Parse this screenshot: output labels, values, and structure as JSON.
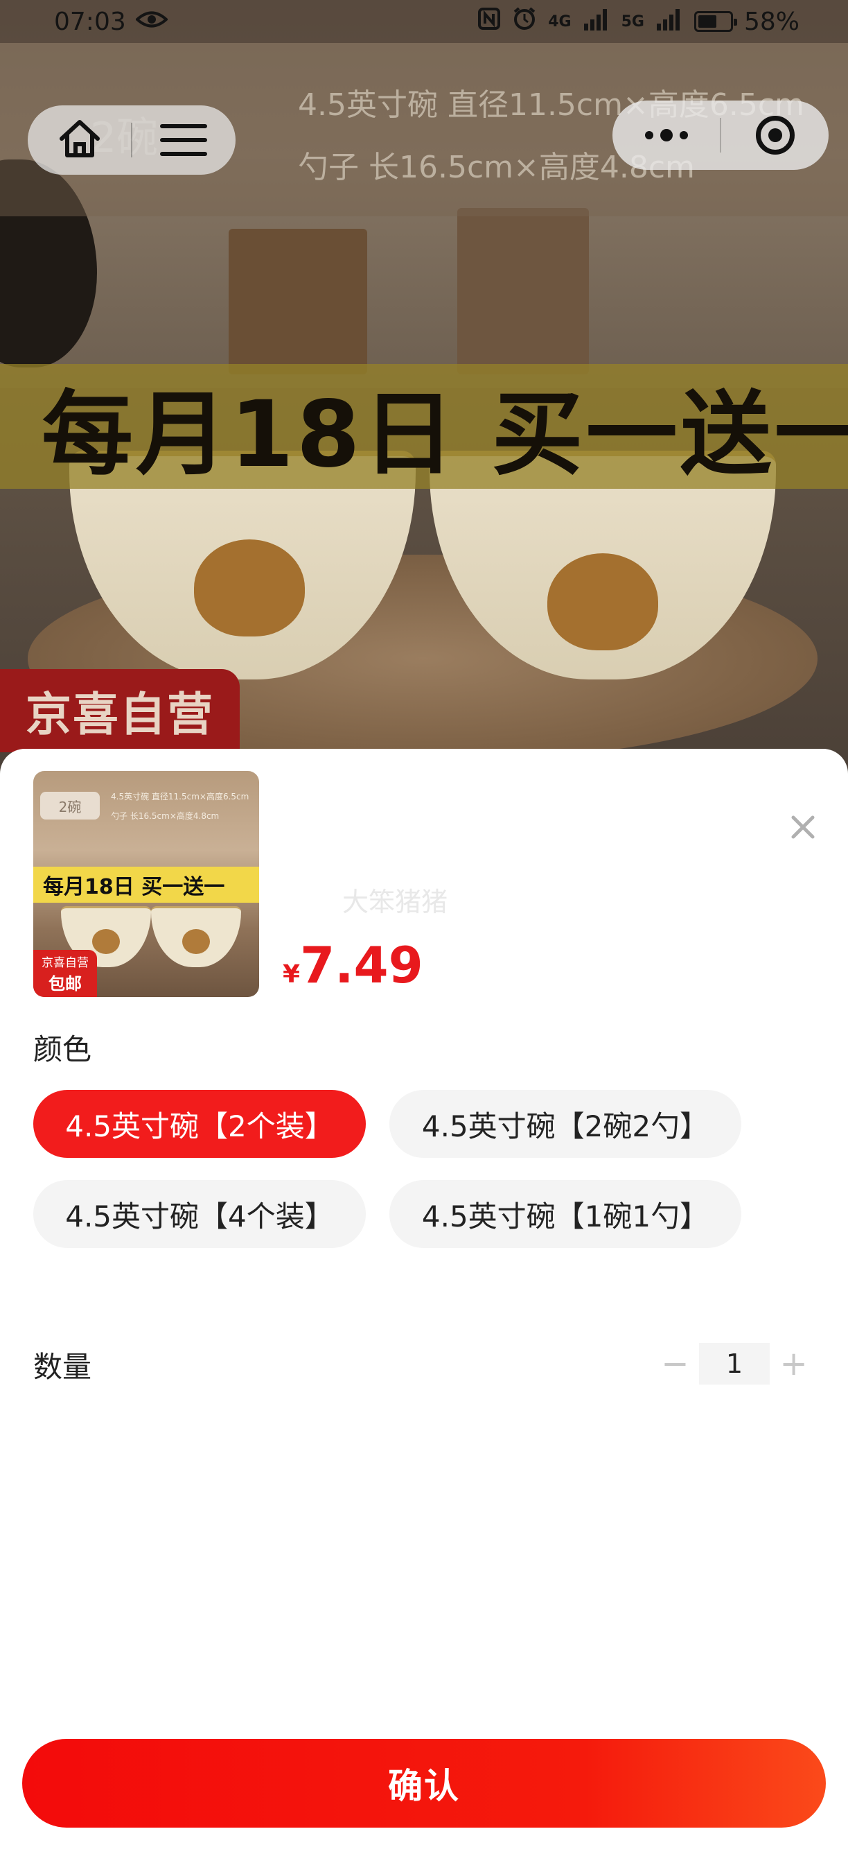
{
  "status_bar": {
    "time": "07:03",
    "battery": "58%",
    "signal_1": "4G",
    "signal_2": "5G"
  },
  "hero": {
    "spec_line_1": "4.5英寸碗 直径11.5cm×高度6.5cm",
    "spec_line_2": "勺子 长16.5cm×高度4.8cm",
    "tag": "2碗",
    "banner": "每月18日 买一送一",
    "store_tag": "京喜自营"
  },
  "sheet": {
    "thumbnail": {
      "tag": "2碗",
      "spec_line_1": "4.5英寸碗 直径11.5cm×高度6.5cm",
      "spec_line_2": "勺子 长16.5cm×高度4.8cm",
      "banner": "每月18日 买一送一",
      "badge_top": "京喜自营",
      "badge_bottom": "包邮"
    },
    "watermark": "大笨猪猪",
    "price_currency": "¥",
    "price_amount": "7.49",
    "color_label": "颜色",
    "options": [
      {
        "label": "4.5英寸碗【2个装】",
        "selected": true
      },
      {
        "label": "4.5英寸碗【2碗2勺】",
        "selected": false
      },
      {
        "label": "4.5英寸碗【4个装】",
        "selected": false
      },
      {
        "label": "4.5英寸碗【1碗1勺】",
        "selected": false
      }
    ],
    "quantity_label": "数量",
    "quantity_value": "1",
    "minus": "−",
    "plus": "+",
    "confirm_label": "确认"
  },
  "colors": {
    "accent": "#f21c1c",
    "price": "#e8191d",
    "option_bg": "#f4f4f4"
  }
}
